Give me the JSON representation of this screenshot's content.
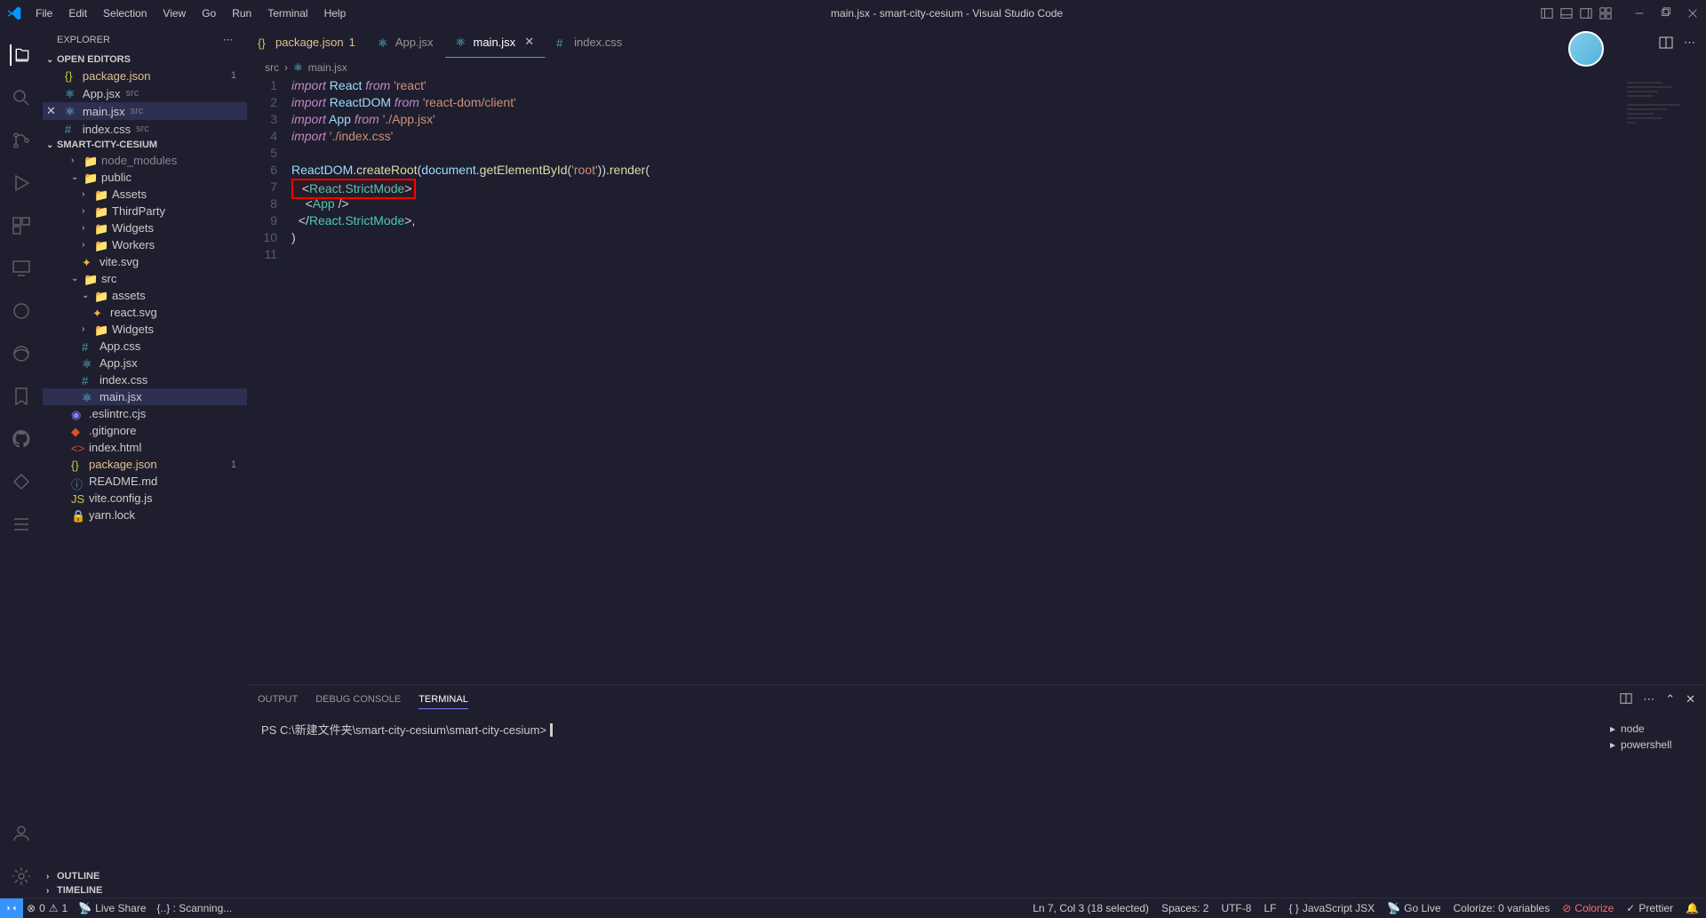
{
  "title": "main.jsx - smart-city-cesium - Visual Studio Code",
  "menu": [
    "File",
    "Edit",
    "Selection",
    "View",
    "Go",
    "Run",
    "Terminal",
    "Help"
  ],
  "explorer": {
    "title": "EXPLORER",
    "sections": {
      "openEditors": "OPEN EDITORS",
      "project": "SMART-CITY-CESIUM",
      "outline": "OUTLINE",
      "timeline": "TIMELINE"
    },
    "editors": [
      {
        "name": "package.json",
        "src": "",
        "modified": true,
        "badge": "1",
        "icon": "json"
      },
      {
        "name": "App.jsx",
        "src": "src",
        "icon": "react"
      },
      {
        "name": "main.jsx",
        "src": "src",
        "active": true,
        "icon": "react"
      },
      {
        "name": "index.css",
        "src": "src",
        "icon": "css"
      }
    ],
    "tree": [
      {
        "name": "node_modules",
        "type": "folder",
        "indent": 1,
        "expanded": false,
        "dim": true
      },
      {
        "name": "public",
        "type": "folder",
        "indent": 1,
        "expanded": true
      },
      {
        "name": "Assets",
        "type": "folder",
        "indent": 2,
        "expanded": false
      },
      {
        "name": "ThirdParty",
        "type": "folder",
        "indent": 2,
        "expanded": false
      },
      {
        "name": "Widgets",
        "type": "folder",
        "indent": 2,
        "expanded": false
      },
      {
        "name": "Workers",
        "type": "folder",
        "indent": 2,
        "expanded": false
      },
      {
        "name": "vite.svg",
        "type": "file",
        "indent": 2,
        "icon": "svg"
      },
      {
        "name": "src",
        "type": "folder",
        "indent": 1,
        "expanded": true
      },
      {
        "name": "assets",
        "type": "folder",
        "indent": 2,
        "expanded": true
      },
      {
        "name": "react.svg",
        "type": "file",
        "indent": 3,
        "icon": "svg"
      },
      {
        "name": "Widgets",
        "type": "folder",
        "indent": 2,
        "expanded": false
      },
      {
        "name": "App.css",
        "type": "file",
        "indent": 2,
        "icon": "css"
      },
      {
        "name": "App.jsx",
        "type": "file",
        "indent": 2,
        "icon": "react"
      },
      {
        "name": "index.css",
        "type": "file",
        "indent": 2,
        "icon": "css"
      },
      {
        "name": "main.jsx",
        "type": "file",
        "indent": 2,
        "icon": "react",
        "selected": true
      },
      {
        "name": ".eslintrc.cjs",
        "type": "file",
        "indent": 1,
        "icon": "eslint"
      },
      {
        "name": ".gitignore",
        "type": "file",
        "indent": 1,
        "icon": "git"
      },
      {
        "name": "index.html",
        "type": "file",
        "indent": 1,
        "icon": "html"
      },
      {
        "name": "package.json",
        "type": "file",
        "indent": 1,
        "icon": "json",
        "modified": true,
        "badge": "1"
      },
      {
        "name": "README.md",
        "type": "file",
        "indent": 1,
        "icon": "md"
      },
      {
        "name": "vite.config.js",
        "type": "file",
        "indent": 1,
        "icon": "js"
      },
      {
        "name": "yarn.lock",
        "type": "file",
        "indent": 1,
        "icon": "lock"
      }
    ]
  },
  "tabs": [
    {
      "name": "package.json",
      "icon": "json",
      "modified": true,
      "badge": "1"
    },
    {
      "name": "App.jsx",
      "icon": "react"
    },
    {
      "name": "main.jsx",
      "icon": "react",
      "active": true
    },
    {
      "name": "index.css",
      "icon": "css"
    }
  ],
  "breadcrumbs": [
    "src",
    "main.jsx"
  ],
  "code": {
    "lines": [
      {
        "n": 1,
        "html": "<span class='kw'>import</span> <span class='var'>React</span> <span class='kw'>from</span> <span class='str'>'react'</span>"
      },
      {
        "n": 2,
        "html": "<span class='kw'>import</span> <span class='var'>ReactDOM</span> <span class='kw'>from</span> <span class='str'>'react-dom/client'</span>"
      },
      {
        "n": 3,
        "html": "<span class='kw'>import</span> <span class='var'>App</span> <span class='kw'>from</span> <span class='str'>'./App.jsx'</span>"
      },
      {
        "n": 4,
        "html": "<span class='kw'>import</span> <span class='str'>'./index.css'</span>"
      },
      {
        "n": 5,
        "html": ""
      },
      {
        "n": 6,
        "html": "<span class='var'>ReactDOM</span><span class='punc'>.</span><span class='fn'>createRoot</span><span class='punc'>(</span><span class='var'>document</span><span class='punc'>.</span><span class='fn'>getElementById</span><span class='punc'>(</span><span class='str'>'root'</span><span class='punc'>)).</span><span class='fn'>render</span><span class='punc'>(</span>"
      },
      {
        "n": 7,
        "html": "<span class='highlight-box'>  <span class='punc'>&lt;</span><span class='comp'>React.StrictMode</span><span class='punc'>&gt;</span></span>"
      },
      {
        "n": 8,
        "html": "    <span class='punc'>&lt;</span><span class='comp'>App</span> <span class='punc'>/&gt;</span>"
      },
      {
        "n": 9,
        "html": "  <span class='punc'>&lt;/</span><span class='comp'>React.StrictMode</span><span class='punc'>&gt;,</span>"
      },
      {
        "n": 10,
        "html": "<span class='punc'>)</span>"
      },
      {
        "n": 11,
        "html": ""
      }
    ]
  },
  "panel": {
    "tabs": [
      "OUTPUT",
      "DEBUG CONSOLE",
      "TERMINAL"
    ],
    "activeTab": "TERMINAL",
    "prompt": "PS C:\\新建文件夹\\smart-city-cesium\\smart-city-cesium> ",
    "shells": [
      "node",
      "powershell"
    ]
  },
  "status": {
    "errors": "0",
    "warnings": "1",
    "liveShare": "Live Share",
    "scanning": "{..} : Scanning...",
    "cursor": "Ln 7, Col 3 (18 selected)",
    "spaces": "Spaces: 2",
    "encoding": "UTF-8",
    "eol": "LF",
    "language": "JavaScript JSX",
    "goLive": "Go Live",
    "colorize": "Colorize: 0 variables",
    "colorizeIcon": "Colorize",
    "prettier": "Prettier"
  }
}
